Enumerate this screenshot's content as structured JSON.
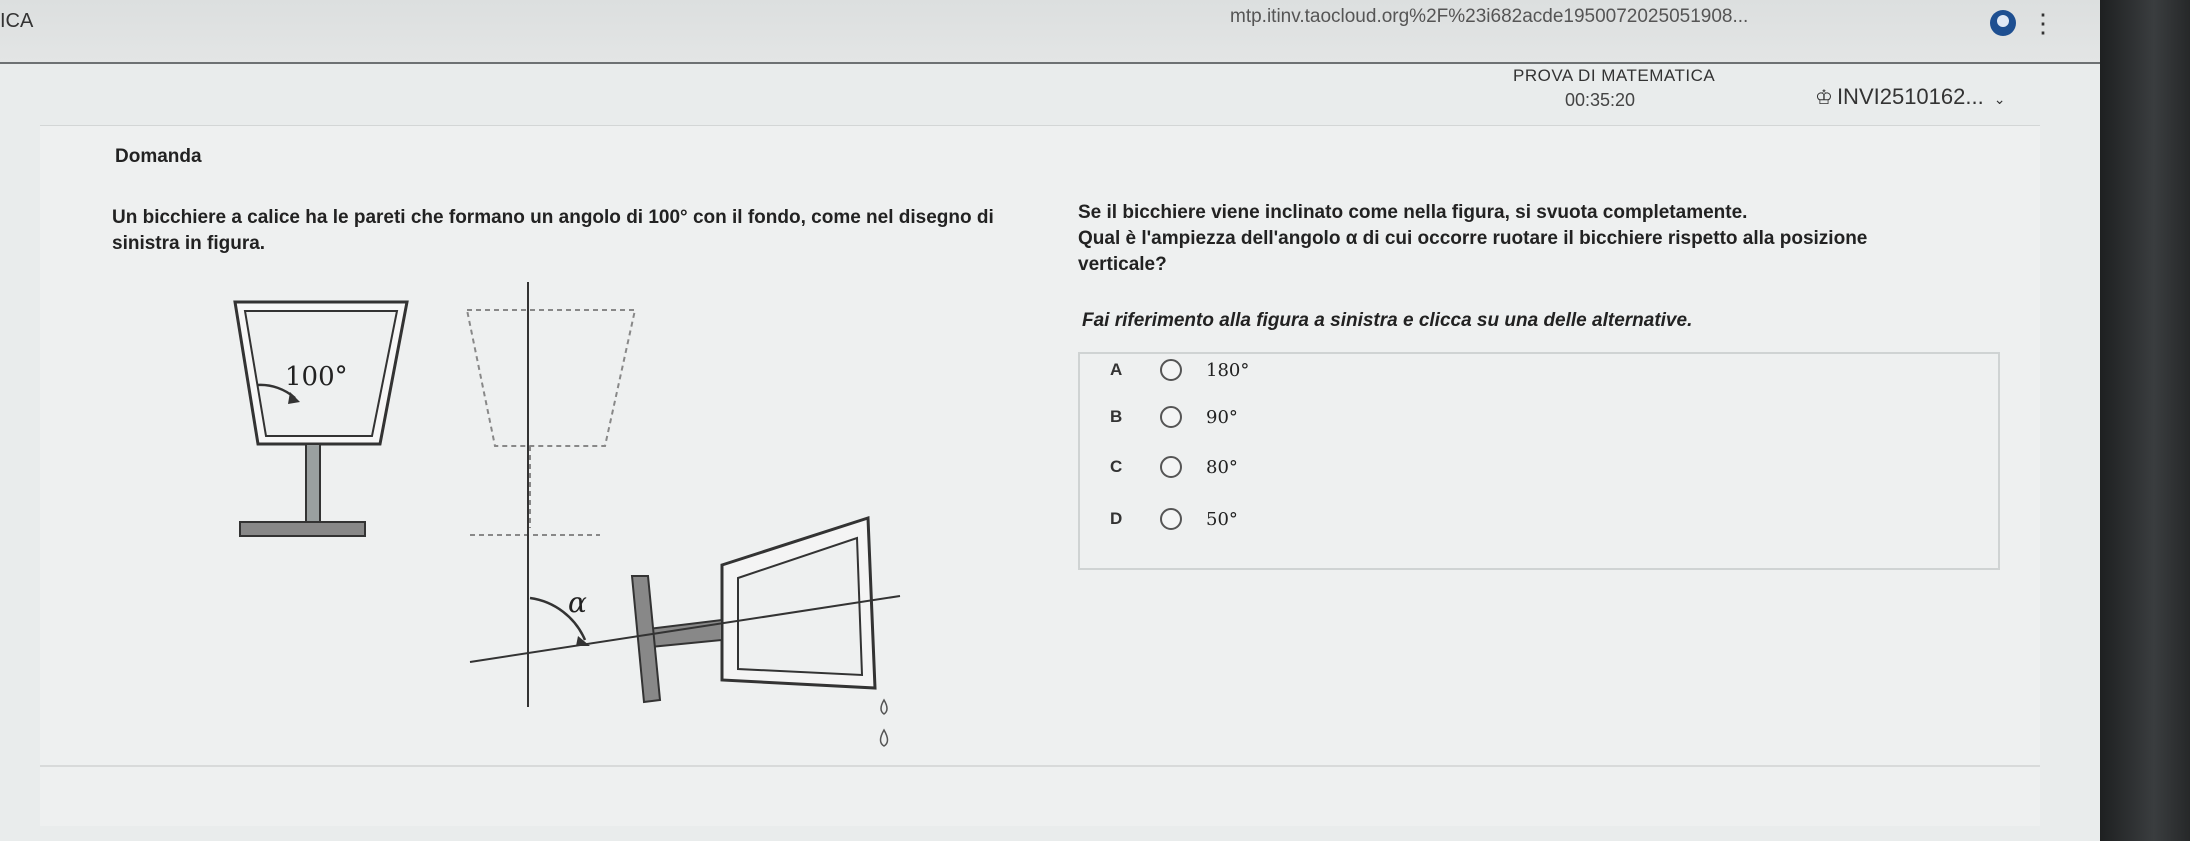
{
  "browser": {
    "app_title": "ICA",
    "url": "mtp.itinv.taocloud.org%2F%23i682acde1950072025051908..."
  },
  "exam": {
    "title": "PROVA DI MATEMATICA",
    "timer": "00:35:20",
    "user_id": "INVI2510162..."
  },
  "question": {
    "header": "Domanda",
    "text": "Un bicchiere a calice ha le pareti che formano un angolo di 100° con il fondo, come nel disegno di sinistra in figura.",
    "figure_angle_label": "100°",
    "figure_alpha_label": "α",
    "prompt_1": "Se il bicchiere viene inclinato come nella figura, si svuota completamente.",
    "prompt_2": "Qual è l'ampiezza dell'angolo α di cui occorre ruotare il bicchiere rispetto alla posizione",
    "prompt_3": "verticale?",
    "instruction": "Fai riferimento alla figura a sinistra e clicca su una delle alternative."
  },
  "choices": [
    {
      "letter": "A",
      "value": "180°"
    },
    {
      "letter": "B",
      "value": "90°"
    },
    {
      "letter": "C",
      "value": "80°"
    },
    {
      "letter": "D",
      "value": "50°"
    }
  ]
}
